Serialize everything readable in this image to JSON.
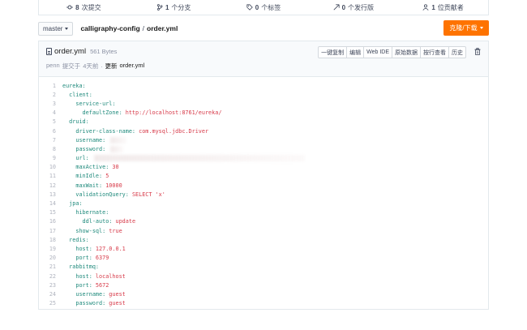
{
  "stats": [
    {
      "icon": "commit-icon",
      "count": "8",
      "label": "次提交"
    },
    {
      "icon": "branch-icon",
      "count": "1",
      "label": "个分支"
    },
    {
      "icon": "tag-icon",
      "count": "0",
      "label": "个标签"
    },
    {
      "icon": "release-icon",
      "count": "0",
      "label": "个发行版"
    },
    {
      "icon": "contributor-icon",
      "count": "1",
      "label": "位贡献者"
    }
  ],
  "branch": {
    "name": "master"
  },
  "breadcrumb": {
    "repo": "calligraphy-config",
    "separator": "/",
    "file": "order.yml"
  },
  "clone_button": {
    "label": "克隆/下载"
  },
  "file": {
    "name": "order.yml",
    "size": "561 Bytes",
    "commit": {
      "author": "penn",
      "verb": "提交于",
      "time": "4天前",
      "dot": ".",
      "message_prefix": "更新",
      "message_file": "order.yml"
    }
  },
  "toolbar": [
    "一键复制",
    "编辑",
    "Web IDE",
    "原始数据",
    "按行查看",
    "历史"
  ],
  "code_lines": [
    {
      "n": "1",
      "indent": "",
      "key": "eureka:",
      "val": ""
    },
    {
      "n": "2",
      "indent": "  ",
      "key": "client:",
      "val": ""
    },
    {
      "n": "3",
      "indent": "    ",
      "key": "service-url:",
      "val": ""
    },
    {
      "n": "4",
      "indent": "      ",
      "key": "defaultZone: ",
      "val": "http://localhost:8761/eureka/"
    },
    {
      "n": "5",
      "indent": "  ",
      "key": "druid:",
      "val": ""
    },
    {
      "n": "6",
      "indent": "    ",
      "key": "driver-class-name: ",
      "val": "com.mysql.jdbc.Driver"
    },
    {
      "n": "7",
      "indent": "    ",
      "key": "username:",
      "val": "",
      "redact": 20
    },
    {
      "n": "8",
      "indent": "    ",
      "key": "password:",
      "val": "",
      "redact": 16
    },
    {
      "n": "9",
      "indent": "    ",
      "key": "url:",
      "val": "",
      "redact": 260
    },
    {
      "n": "10",
      "indent": "    ",
      "key": "maxActive: ",
      "val": "30"
    },
    {
      "n": "11",
      "indent": "    ",
      "key": "minIdle: ",
      "val": "5"
    },
    {
      "n": "12",
      "indent": "    ",
      "key": "maxWait: ",
      "val": "10000"
    },
    {
      "n": "13",
      "indent": "    ",
      "key": "validationQuery: ",
      "val": "SELECT 'x'"
    },
    {
      "n": "14",
      "indent": "  ",
      "key": "jpa:",
      "val": ""
    },
    {
      "n": "15",
      "indent": "    ",
      "key": "hibernate:",
      "val": ""
    },
    {
      "n": "16",
      "indent": "      ",
      "key": "ddl-auto: ",
      "val": "update"
    },
    {
      "n": "17",
      "indent": "    ",
      "key": "show-sql: ",
      "val": "true"
    },
    {
      "n": "18",
      "indent": "  ",
      "key": "redis:",
      "val": ""
    },
    {
      "n": "19",
      "indent": "    ",
      "key": "host: ",
      "val": "127.0.0.1"
    },
    {
      "n": "20",
      "indent": "    ",
      "key": "port: ",
      "val": "6379"
    },
    {
      "n": "21",
      "indent": "  ",
      "key": "rabbitmq:",
      "val": ""
    },
    {
      "n": "22",
      "indent": "    ",
      "key": "host: ",
      "val": "localhost"
    },
    {
      "n": "23",
      "indent": "    ",
      "key": "port: ",
      "val": "5672"
    },
    {
      "n": "24",
      "indent": "    ",
      "key": "username: ",
      "val": "guest"
    },
    {
      "n": "25",
      "indent": "    ",
      "key": "password: ",
      "val": "guest"
    }
  ],
  "colors": {
    "accent": "#fe7300",
    "key": "#1f8a7c",
    "value": "#d73a49"
  }
}
